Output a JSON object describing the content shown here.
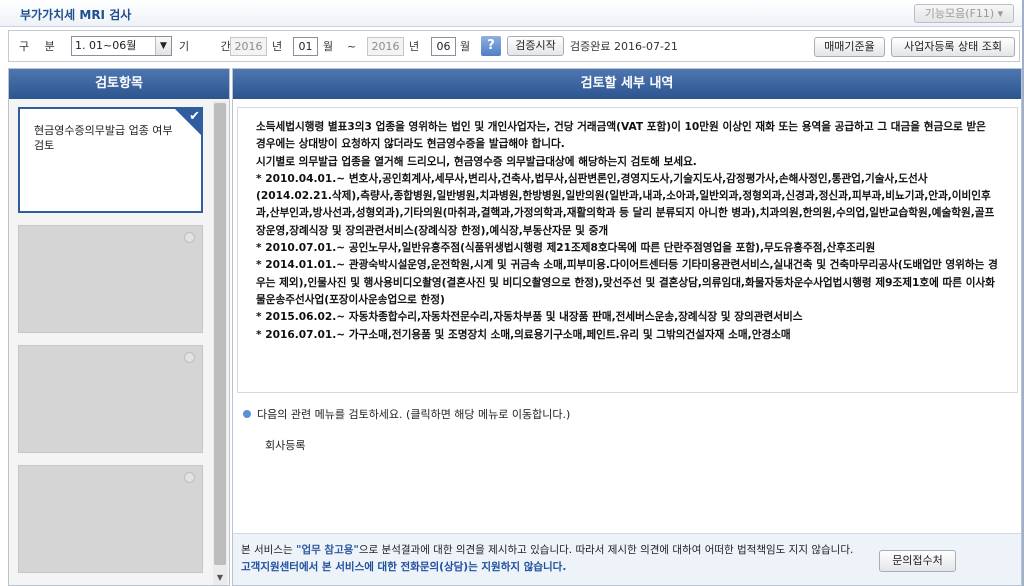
{
  "titlebar": {
    "title": "부가가치세 MRI 검사",
    "function_menu": "기능모음(F11) ▾"
  },
  "filter": {
    "division_label": "구 분",
    "division_value": "1. 01~06월",
    "period_label": "기 간",
    "start_year": "2016",
    "year_unit": "년",
    "start_month": "01",
    "month_unit": "월",
    "tilde": "~",
    "end_year": "2016",
    "end_month": "06",
    "help": "?",
    "start_button": "검증시작",
    "status": "검증완료 2016-07-21",
    "sales_button": "매매기준율",
    "business_button": "사업자등록 상태 조회"
  },
  "left": {
    "header": "검토항목",
    "cards": [
      {
        "text": "현금영수증의무발급 업종 여부 검토"
      }
    ]
  },
  "right": {
    "header": "검토할 세부 내역",
    "paragraphs": [
      "소득세법시행령 별표3의3 업종을 영위하는 법인 및 개인사업자는, 건당 거래금액(VAT 포함)이 10만원 이상인 재화 또는 용역을 공급하고 그 대금을 현금으로 받은 경우에는 상대방이 요청하지 않더라도 현금영수증을 발급해야 합니다.",
      "시기별로 의무발급 업종을 열거해 드리오니, 현금영수증 의무발급대상에 해당하는지 검토해 보세요.",
      "* 2010.04.01.~ 변호사,공인회계사,세무사,변리사,건축사,법무사,심판변론인,경영지도사,기술지도사,감정평가사,손해사정인,통관업,기술사,도선사(2014.02.21.삭제),측량사,종합병원,일반병원,치과병원,한방병원,일반의원(일반과,내과,소아과,일반외과,정형외과,신경과,정신과,피부과,비뇨기과,안과,이비인후과,산부인과,방사선과,성형외과),기타의원(마취과,결핵과,가정의학과,재활의학과 등 달리 분류되지 아니한 병과),치과의원,한의원,수의업,일반교습학원,예술학원,골프장운영,장례식장 및 장의관련서비스(장례식장 한정),예식장,부동산자문 및 중개",
      "* 2010.07.01.~ 공인노무사,일반유흥주점(식품위생법시행령 제21조제8호다목에 따른 단란주점영업을 포함),무도유흥주점,산후조리원",
      "* 2014.01.01.~ 관광숙박시설운영,운전학원,시계 및 귀금속 소매,피부미용.다이어트센터등 기타미용관련서비스,실내건축 및 건축마무리공사(도배업만 영위하는 경우는 제외),인물사진 및 행사용비디오촬영(결혼사진 및 비디오촬영으로 한정),맞선주선 및 결혼상담,의류임대,화물자동차운수사업법시행령 제9조제1호에 따른 이사화물운송주선사업(포장이사운송업으로 한정)",
      "* 2015.06.02.~ 자동차종합수리,자동차전문수리,자동차부품 및 내장품 판매,전세버스운송,장례식장 및 장의관련서비스",
      "* 2016.07.01.~ 가구소매,전기용품 및 조명장치 소매,의료용기구소매,페인트.유리 및 그밖의건설자재 소매,안경소매"
    ],
    "related_title": "다음의 관련 메뉴를 검토하세요. (클릭하면 해당 메뉴로 이동합니다.)",
    "related_item": "회사등록"
  },
  "footer": {
    "text1": "본 서비스는 ",
    "highlight1": "\"업무 참고용\"",
    "text2": "으로 분석결과에 대한 의견을 제시하고 있습니다. 따라서 제시한 의견에 대하여 어떠한 법적책임도 지지 않습니다. ",
    "highlight2": "고객지원센터에서 본 서비스에 대한 전화문의(상담)는 지원하지 않습니다.",
    "inquiry_button": "문의접수처"
  },
  "colors": {
    "header_blue": "#2c548f",
    "accent": "#2f5da0"
  }
}
